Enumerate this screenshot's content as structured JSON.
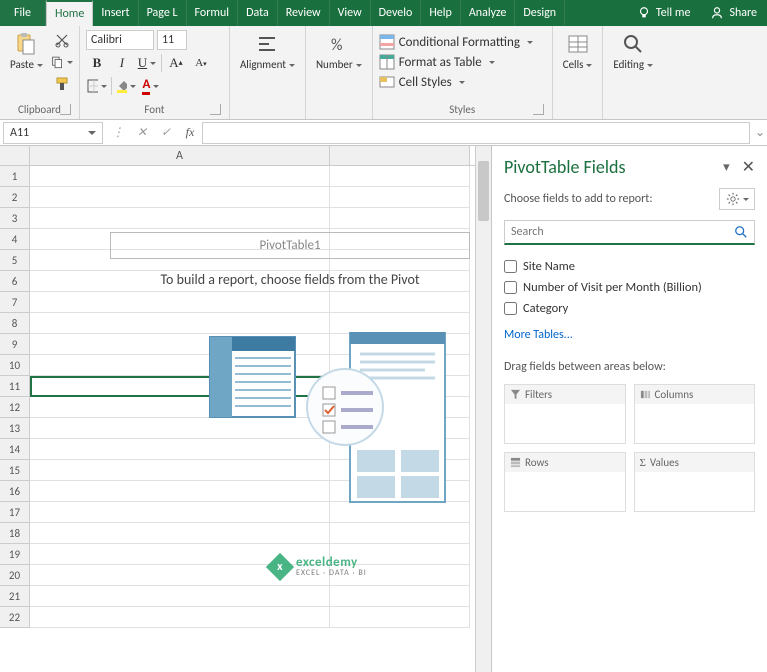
{
  "tabs": {
    "file": "File",
    "list": [
      "Home",
      "Insert",
      "Page L",
      "Formul",
      "Data",
      "Review",
      "View",
      "Develo",
      "Help",
      "Analyze",
      "Design"
    ],
    "active": "Home",
    "tellme": "Tell me",
    "share": "Share"
  },
  "ribbon": {
    "clipboard": {
      "label": "Clipboard",
      "paste": "Paste"
    },
    "font": {
      "label": "Font",
      "name": "Calibri",
      "size": "11"
    },
    "alignment": {
      "label": "Alignment"
    },
    "number": {
      "label": "Number"
    },
    "styles": {
      "label": "Styles",
      "condfmt": "Conditional Formatting",
      "table": "Format as Table",
      "cellstyles": "Cell Styles"
    },
    "cells": {
      "label": "Cells"
    },
    "editing": {
      "label": "Editing"
    }
  },
  "formulabar": {
    "namebox": "A11"
  },
  "sheet": {
    "cols": [
      "A"
    ],
    "rows": [
      "1",
      "2",
      "3",
      "4",
      "5",
      "6",
      "7",
      "8",
      "9",
      "10",
      "11",
      "12",
      "13",
      "14",
      "15",
      "16",
      "17",
      "18",
      "19",
      "20",
      "21",
      "22"
    ],
    "pivot_title": "PivotTable1",
    "pivot_hint": "To build a report, choose fields from the Pivot"
  },
  "pane": {
    "title": "PivotTable Fields",
    "subtitle": "Choose fields to add to report:",
    "search_placeholder": "Search",
    "fields": [
      "Site Name",
      "Number of Visit per Month (Billion)",
      "Category"
    ],
    "more": "More Tables...",
    "areas_label": "Drag fields between areas below:",
    "area_filters": "Filters",
    "area_columns": "Columns",
    "area_rows": "Rows",
    "area_values": "Values"
  },
  "watermark": {
    "brand": "exceldemy",
    "tagline": "EXCEL · DATA · BI"
  }
}
